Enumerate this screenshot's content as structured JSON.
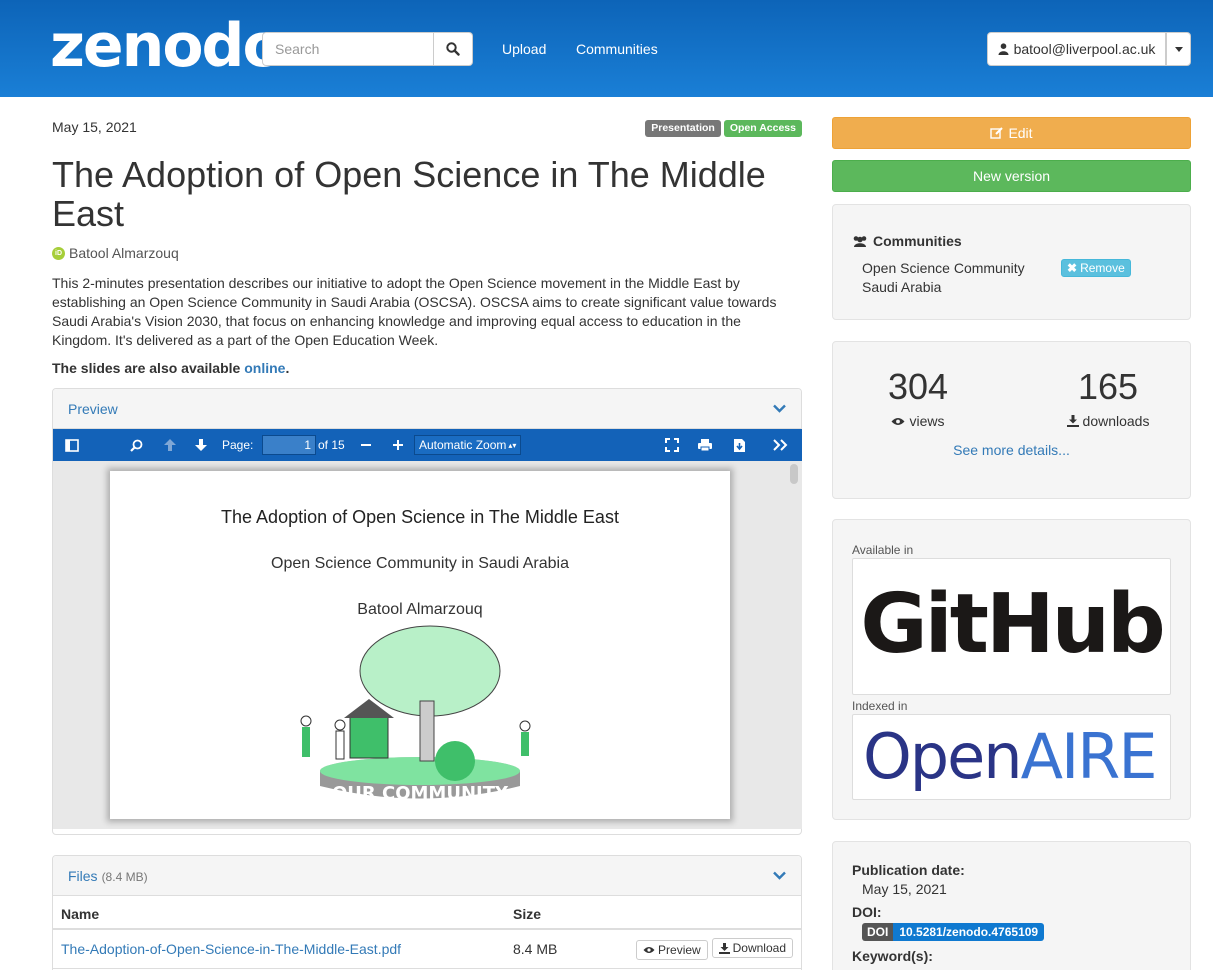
{
  "header": {
    "logo": "zenodo",
    "search_placeholder": "Search",
    "nav": [
      "Upload",
      "Communities"
    ],
    "user": "batool@liverpool.ac.uk"
  },
  "record": {
    "date": "May 15, 2021",
    "badges": [
      "Presentation",
      "Open Access"
    ],
    "title": "The Adoption of Open Science in The Middle East",
    "author": "Batool Almarzouq",
    "description": "This 2-minutes presentation describes our initiative to adopt the Open Science movement in the Middle East by establishing an Open Science Community in Saudi Arabia (OSCSA). OSCSA  aims to create significant value towards Saudi Arabia's Vision 2030, that focus on enhancing knowledge and improving equal access to education in the Kingdom. It's delivered as a part of the Open Education Week.",
    "slides_note": "The slides are also available ",
    "slides_link": "online",
    "slides_end": "."
  },
  "preview": {
    "heading": "Preview",
    "page_label": "Page:",
    "page_value": "1",
    "page_total": "of 15",
    "zoom": "Automatic Zoom",
    "slide_title": "The Adoption of Open Science in The Middle East",
    "slide_subtitle": "Open Science Community in Saudi Arabia",
    "slide_author": "Batool Almarzouq",
    "slide_banner": "OUR COMMUNITY"
  },
  "files": {
    "heading": "Files",
    "size_total": "(8.4 MB)",
    "columns": [
      "Name",
      "Size"
    ],
    "rows": [
      {
        "name": "The-Adoption-of-Open-Science-in-The-Middle-East.pdf",
        "size": "8.4 MB"
      }
    ],
    "preview_btn": "Preview",
    "download_btn": "Download"
  },
  "sidebar": {
    "edit": "Edit",
    "new_version": "New version",
    "communities_heading": "Communities",
    "community_name": "Open Science Community Saudi Arabia",
    "remove": "Remove",
    "views": "304",
    "views_label": "views",
    "downloads": "165",
    "downloads_label": "downloads",
    "more_details": "See more details...",
    "available_in": "Available in",
    "github": "GitHub",
    "indexed_in": "Indexed in",
    "openaire_open": "Open",
    "openaire_aire": "AIRE",
    "pub_date_label": "Publication date:",
    "pub_date": "May 15, 2021",
    "doi_label": "DOI:",
    "doi_key": "DOI",
    "doi_value": "10.5281/zenodo.4765109",
    "keywords_label": "Keyword(s):"
  },
  "colors": {
    "header": "#1a7fd6",
    "edit": "#f0ad4e",
    "new_version": "#5cb85c",
    "link": "#337ab7",
    "pdf_toolbar": "#1362b8"
  }
}
